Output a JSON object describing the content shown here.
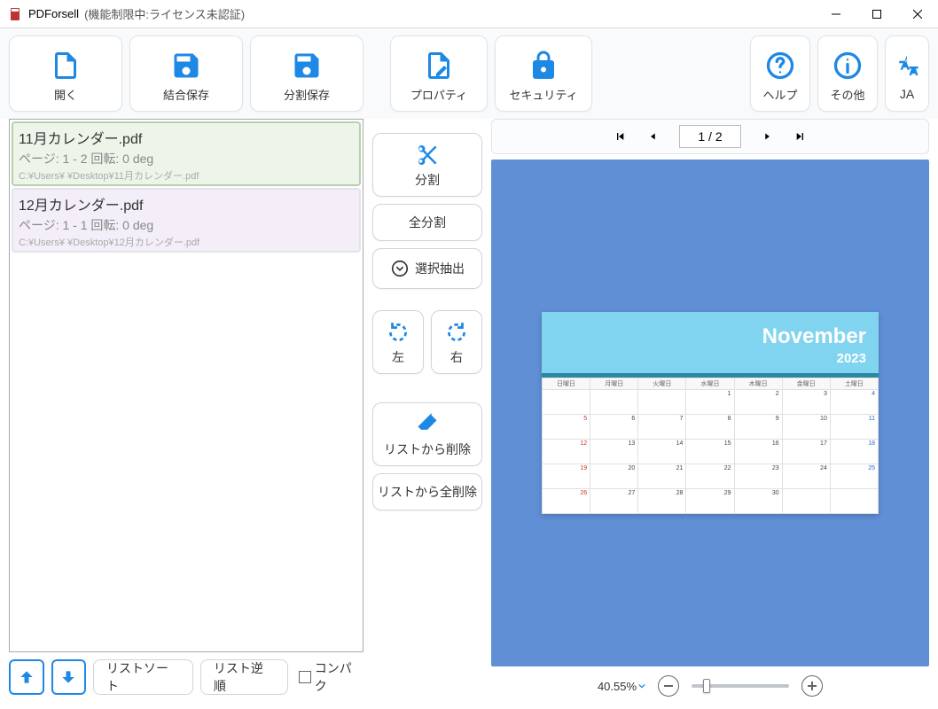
{
  "titlebar": {
    "app_name": "PDForsell",
    "status": "(機能制限中:ライセンス未認証)"
  },
  "toolbar": {
    "open": "開く",
    "merge_save": "結合保存",
    "split_save": "分割保存",
    "property": "プロパティ",
    "security": "セキュリティ",
    "help": "ヘルプ",
    "other": "その他",
    "lang": "JA"
  },
  "filelist": {
    "items": [
      {
        "name": "11月カレンダー.pdf",
        "info": "ページ:   1 - 2      回転:   0 deg",
        "path": "C:¥Users¥        ¥Desktop¥11月カレンダー.pdf"
      },
      {
        "name": "12月カレンダー.pdf",
        "info": "ページ:   1 - 1      回転:   0 deg",
        "path": "C:¥Users¥        ¥Desktop¥12月カレンダー.pdf"
      }
    ]
  },
  "listbtns": {
    "sort": "リストソート",
    "reverse": "リスト逆順",
    "compact": "コンパク"
  },
  "midtools": {
    "split": "分割",
    "split_all": "全分割",
    "select_extract": "選択抽出",
    "rot_left": "左",
    "rot_right": "右",
    "delete_from_list": "リストから削除",
    "delete_all_from_list": "リストから全削除"
  },
  "pagenav": {
    "value": "1 / 2"
  },
  "zoom": {
    "label": "40.55%",
    "pos_pct": 12
  },
  "calendar": {
    "month": "November",
    "year": "2023",
    "dow": [
      "日曜日",
      "月曜日",
      "火曜日",
      "水曜日",
      "木曜日",
      "金曜日",
      "土曜日"
    ],
    "rows": [
      [
        "",
        "",
        "",
        "1",
        "2",
        "3",
        "4"
      ],
      [
        "5",
        "6",
        "7",
        "8",
        "9",
        "10",
        "11"
      ],
      [
        "12",
        "13",
        "14",
        "15",
        "16",
        "17",
        "18"
      ],
      [
        "19",
        "20",
        "21",
        "22",
        "23",
        "24",
        "25"
      ],
      [
        "26",
        "27",
        "28",
        "29",
        "30",
        "",
        ""
      ]
    ]
  }
}
